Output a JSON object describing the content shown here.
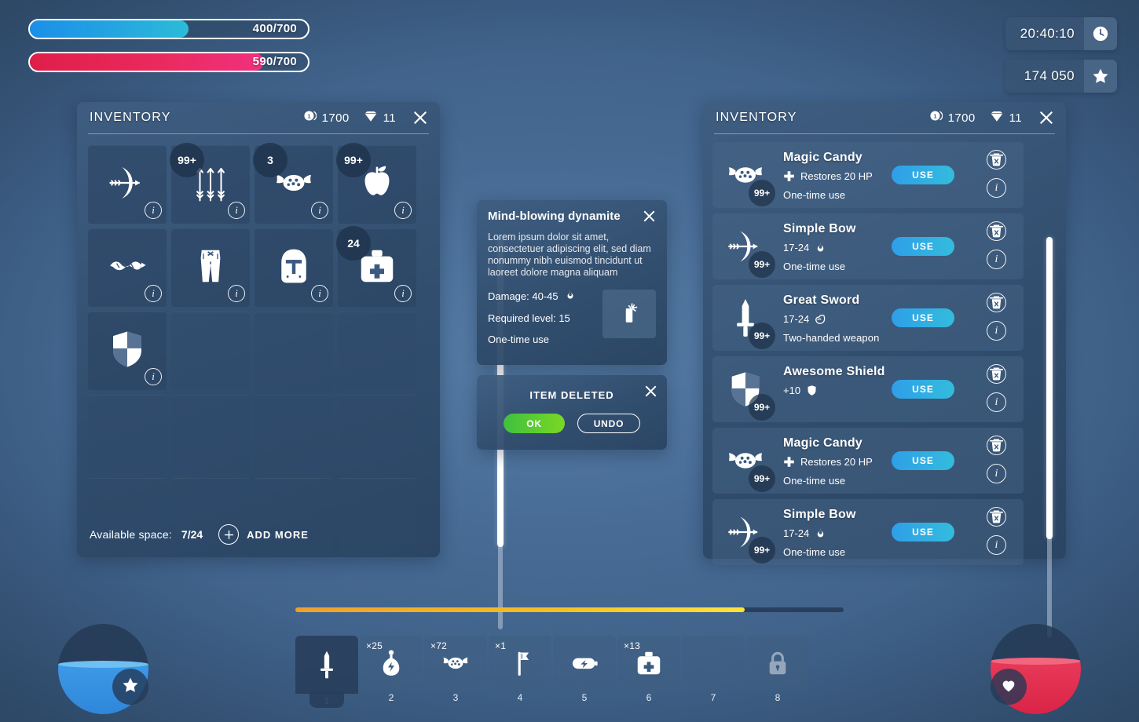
{
  "hud": {
    "mana_bar": {
      "label": "400/700",
      "value": 400,
      "max": 700,
      "color": "#25a8e0",
      "name": "mana"
    },
    "health_bar": {
      "label": "590/700",
      "value": 590,
      "max": 700,
      "color": "#ea2a5e",
      "name": "health"
    },
    "timer": {
      "value": "20:40:10",
      "icon": "clock-icon"
    },
    "score": {
      "value": "174 050",
      "icon": "star-icon"
    },
    "xp": {
      "percent": 82
    },
    "mana_orb": {
      "fill_percent": 56,
      "badge_icon": "star-icon"
    },
    "health_orb": {
      "fill_percent": 59,
      "badge_icon": "heart-icon"
    }
  },
  "inventory_left": {
    "title": "INVENTORY",
    "coins": "1700",
    "gems": "11",
    "coin_icon": "coin-icon",
    "gem_icon": "gem-icon",
    "close_icon": "close-icon",
    "info_glyph": "i",
    "slots": [
      {
        "icon": "bow-icon",
        "badge": "",
        "has_item": true
      },
      {
        "icon": "arrows-icon",
        "badge": "99+",
        "has_item": true
      },
      {
        "icon": "candy-icon",
        "badge": "3",
        "has_item": true
      },
      {
        "icon": "apple-icon",
        "badge": "99+",
        "has_item": true
      },
      {
        "icon": "rope-icon",
        "badge": "",
        "has_item": true
      },
      {
        "icon": "pants-icon",
        "badge": "",
        "has_item": true
      },
      {
        "icon": "helmet-icon",
        "badge": "",
        "has_item": true
      },
      {
        "icon": "medkit-icon",
        "badge": "24",
        "has_item": true
      },
      {
        "icon": "shield-icon",
        "badge": "",
        "has_item": true
      },
      {
        "icon": "",
        "badge": "",
        "has_item": false
      },
      {
        "icon": "",
        "badge": "",
        "has_item": false
      },
      {
        "icon": "",
        "badge": "",
        "has_item": false
      },
      {
        "icon": "",
        "badge": "",
        "has_item": false
      },
      {
        "icon": "",
        "badge": "",
        "has_item": false
      },
      {
        "icon": "",
        "badge": "",
        "has_item": false
      },
      {
        "icon": "",
        "badge": "",
        "has_item": false
      },
      {
        "icon": "",
        "badge": "",
        "has_item": false
      },
      {
        "icon": "",
        "badge": "",
        "has_item": false
      },
      {
        "icon": "",
        "badge": "",
        "has_item": false
      },
      {
        "icon": "",
        "badge": "",
        "has_item": false
      }
    ],
    "footer": {
      "space_label": "Available space:",
      "space_value": "7/24",
      "add_more_label": "ADD MORE",
      "add_icon": "plus-icon"
    }
  },
  "inventory_right": {
    "title": "INVENTORY",
    "coins": "1700",
    "gems": "11",
    "coin_icon": "coin-icon",
    "gem_icon": "gem-icon",
    "close_icon": "close-icon",
    "use_label": "USE",
    "delete_icon": "trash-icon",
    "info_glyph": "i",
    "items": [
      {
        "icon": "candy-icon",
        "count": "99+",
        "name": "Magic Candy",
        "stat": "Restores 20 HP",
        "stat_icon": "health-cross-icon",
        "sub": "One-time use"
      },
      {
        "icon": "bow-icon",
        "count": "99+",
        "name": "Simple Bow",
        "stat": "17-24",
        "stat_icon": "flame-icon",
        "sub": "One-time use"
      },
      {
        "icon": "sword-icon",
        "count": "99+",
        "name": "Great Sword",
        "stat": "17-24",
        "stat_icon": "muscle-icon",
        "sub": "Two-handed weapon"
      },
      {
        "icon": "shield-icon",
        "count": "99+",
        "name": "Awesome Shield",
        "stat": "+10",
        "stat_icon": "shield-small-icon",
        "sub": ""
      },
      {
        "icon": "candy-icon",
        "count": "99+",
        "name": "Magic Candy",
        "stat": "Restores 20 HP",
        "stat_icon": "health-cross-icon",
        "sub": "One-time use"
      },
      {
        "icon": "bow-icon",
        "count": "99+",
        "name": "Simple Bow",
        "stat": "17-24",
        "stat_icon": "flame-icon",
        "sub": "One-time use"
      }
    ]
  },
  "tooltip": {
    "title": "Mind-blowing dynamite",
    "description": "Lorem ipsum dolor sit amet, consectetuer adipiscing elit, sed diam nonummy nibh euismod tincidunt ut laoreet dolore magna aliquam",
    "damage_label": "Damage: 40-45",
    "damage_icon": "flame-icon",
    "level_label": "Required level: 15",
    "use_label": "One-time use",
    "thumb_icon": "dynamite-icon",
    "close_icon": "close-icon"
  },
  "dialog": {
    "title": "ITEM DELETED",
    "ok_label": "OK",
    "undo_label": "UNDO",
    "close_icon": "close-icon"
  },
  "hotbar": {
    "slots": [
      {
        "key": "1",
        "qty": "",
        "icon": "sword-icon",
        "active": true,
        "locked": false
      },
      {
        "key": "2",
        "qty": "×25",
        "icon": "potion-icon",
        "active": false,
        "locked": false
      },
      {
        "key": "3",
        "qty": "×72",
        "icon": "candy-icon",
        "active": false,
        "locked": false
      },
      {
        "key": "4",
        "qty": "×1",
        "icon": "axe-icon",
        "active": false,
        "locked": false
      },
      {
        "key": "5",
        "qty": "",
        "icon": "battery-icon",
        "active": false,
        "locked": false
      },
      {
        "key": "6",
        "qty": "×13",
        "icon": "medkit-icon",
        "active": false,
        "locked": false
      },
      {
        "key": "7",
        "qty": "",
        "icon": "",
        "active": false,
        "locked": false
      },
      {
        "key": "8",
        "qty": "",
        "icon": "lock-icon",
        "active": false,
        "locked": true
      }
    ]
  }
}
